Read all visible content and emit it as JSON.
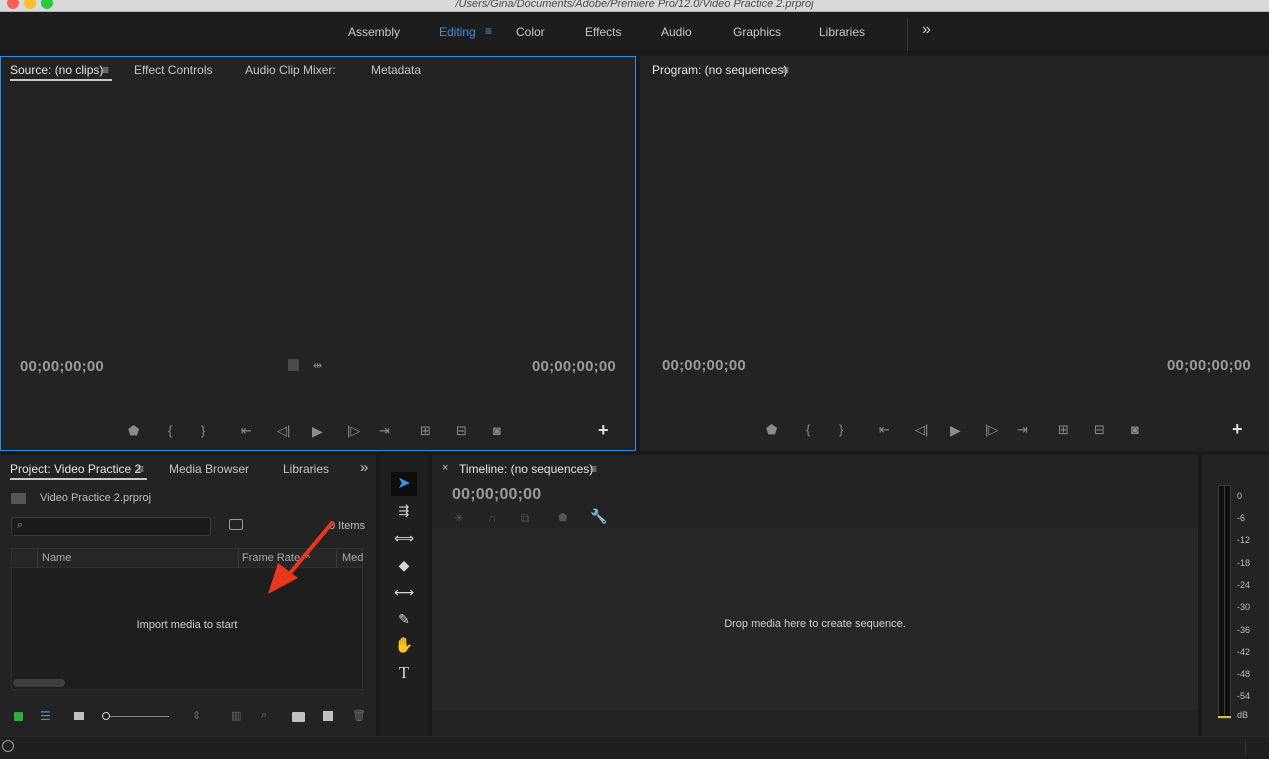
{
  "window": {
    "title": "/Users/Gina/Documents/Adobe/Premiere Pro/12.0/Video Practice 2.prproj"
  },
  "workspace": {
    "tabs": [
      "Assembly",
      "Editing",
      "Color",
      "Effects",
      "Audio",
      "Graphics",
      "Libraries"
    ],
    "active": "Editing",
    "overflow_icon": "»"
  },
  "source_panel": {
    "tabs": [
      "Source: (no clips)",
      "Effect Controls",
      "Audio Clip Mixer:",
      "Metadata"
    ],
    "menu_icon": "≡",
    "timecode_left": "00;00;00;00",
    "timecode_right": "00;00;00;00"
  },
  "program_panel": {
    "title": "Program: (no sequences)",
    "menu_icon": "≡",
    "timecode_left": "00;00;00;00",
    "timecode_right": "00;00;00;00"
  },
  "transport": {
    "add_icon": "+",
    "buttons": [
      "marker-icon",
      "mark-in-icon",
      "mark-out-icon",
      "go-to-in-icon",
      "step-back-icon",
      "play-icon",
      "step-forward-icon",
      "go-to-out-icon",
      "insert-icon",
      "overwrite-icon",
      "export-frame-icon"
    ]
  },
  "project_panel": {
    "tabs": [
      "Project: Video Practice 2",
      "Media Browser",
      "Libraries"
    ],
    "menu_icon": "≡",
    "overflow_icon": "»",
    "file_name": "Video Practice 2.prproj",
    "search_placeholder": "",
    "item_count": "0 Items",
    "columns": [
      "Name",
      "Frame Rate",
      "Med"
    ],
    "empty_message": "Import media to start"
  },
  "tools": [
    "selection",
    "track-select-forward",
    "ripple-edit",
    "razor",
    "slip",
    "pen",
    "hand",
    "type"
  ],
  "timeline_panel": {
    "close_icon": "×",
    "title": "Timeline: (no sequences)",
    "menu_icon": "≡",
    "timecode": "00;00;00;00",
    "drop_message": "Drop media here to create sequence."
  },
  "audio_meter": {
    "labels": [
      "0",
      "-6",
      "-12",
      "-18",
      "-24",
      "-30",
      "-36",
      "-42",
      "-48",
      "-54",
      "dB"
    ]
  },
  "colors": {
    "accent_blue": "#2d8ceb",
    "annotation_arrow": "#e8371f"
  }
}
